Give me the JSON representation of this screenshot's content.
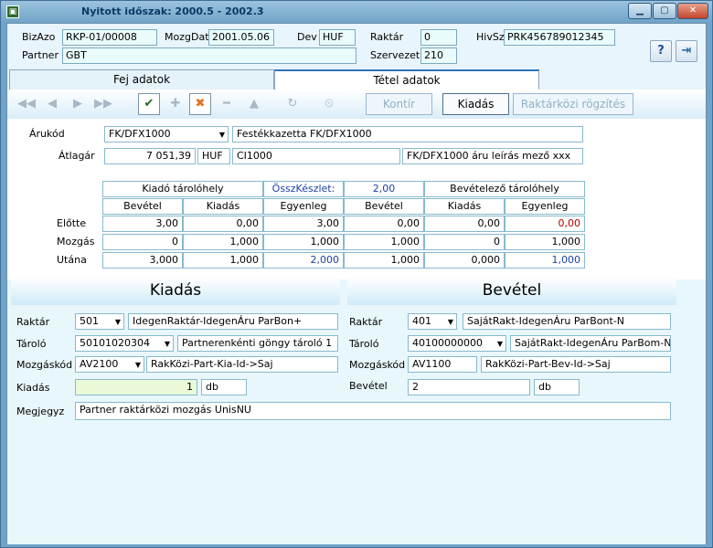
{
  "window": {
    "title": "Nyitott időszak: 2000.5 - 2002.3"
  },
  "header": {
    "bizazo_label": "BizAzo",
    "bizazo_value": "RKP-01/00008",
    "mozgdat_label": "MozgDat",
    "mozgdat_value": "2001.05.06",
    "dev_label": "Dev",
    "dev_value": "HUF",
    "raktar_label": "Raktár",
    "raktar_value": "0",
    "hivsz_label": "HivSz",
    "hivsz_value": "PRK456789012345",
    "partner_label": "Partner",
    "partner_value": "GBT",
    "szervezet_label": "Szervezet",
    "szervezet_value": "210"
  },
  "tabs": {
    "fej": "Fej adatok",
    "tetel": "Tétel adatok"
  },
  "toolbar": {
    "kontir": "Kontír",
    "kiadas": "Kiadás",
    "raktarkozi": "Raktárközi rögzítés"
  },
  "item": {
    "arukod_label": "Árukód",
    "arukod_value": "FK/DFX1000",
    "arukod_name": "Festékkazetta FK/DFX1000",
    "atlagar_label": "Átlagár",
    "atlagar_value": "7 051,39",
    "atlagar_currency": "HUF",
    "code2": "CI1000",
    "description": "FK/DFX1000 áru leírás mező xxx"
  },
  "stock": {
    "kiado_header": "Kiadó tárolóhely",
    "osszkeszlet_label": "ÖsszKészlet:",
    "osszkeszlet_value": "2,00",
    "bevetelezo_header": "Bevételező tárolóhely",
    "columns": [
      "Bevétel",
      "Kiadás",
      "Egyenleg",
      "Bevétel",
      "Kiadás",
      "Egyenleg"
    ],
    "rows": [
      {
        "label": "Előtte",
        "values": [
          "3,00",
          "0,00",
          "3,00",
          "0,00",
          "0,00",
          "0,00"
        ]
      },
      {
        "label": "Mozgás",
        "values": [
          "0",
          "1,000",
          "1,000",
          "1,000",
          "0",
          "1,000"
        ]
      },
      {
        "label": "Utána",
        "values": [
          "3,000",
          "1,000",
          "2,000",
          "1,000",
          "0,000",
          "1,000"
        ]
      }
    ]
  },
  "kiadas": {
    "title": "Kiadás",
    "raktar_label": "Raktár",
    "raktar_code": "501",
    "raktar_name": "IdegenRaktár-IdegenÁru ParBon+",
    "tarolo_label": "Tároló",
    "tarolo_code": "50101020304",
    "tarolo_name": "Partnerenkénti göngy tároló 1",
    "mozgaskod_label": "Mozgáskód",
    "mozgaskod_code": "AV2100",
    "mozgaskod_name": "RakKözi-Part-Kia-Id->Saj",
    "qty_label": "Kiadás",
    "qty_value": "1",
    "qty_unit": "db"
  },
  "bevetel": {
    "title": "Bevétel",
    "raktar_label": "Raktár",
    "raktar_code": "401",
    "raktar_name": "SajátRakt-IdegenÁru ParBont-N",
    "tarolo_label": "Tároló",
    "tarolo_code": "40100000000",
    "tarolo_name": "SajátRakt-IdegenÁru ParBom-N",
    "mozgaskod_label": "Mozgáskód",
    "mozgaskod_code": "AV1100",
    "mozgaskod_name": "RakKözi-Part-Bev-Id->Saj",
    "qty_label": "Bevétel",
    "qty_value": "2",
    "qty_unit": "db"
  },
  "megjegyz": {
    "label": "Megjegyz",
    "value": "Partner raktárközi mozgás UnisNU"
  }
}
